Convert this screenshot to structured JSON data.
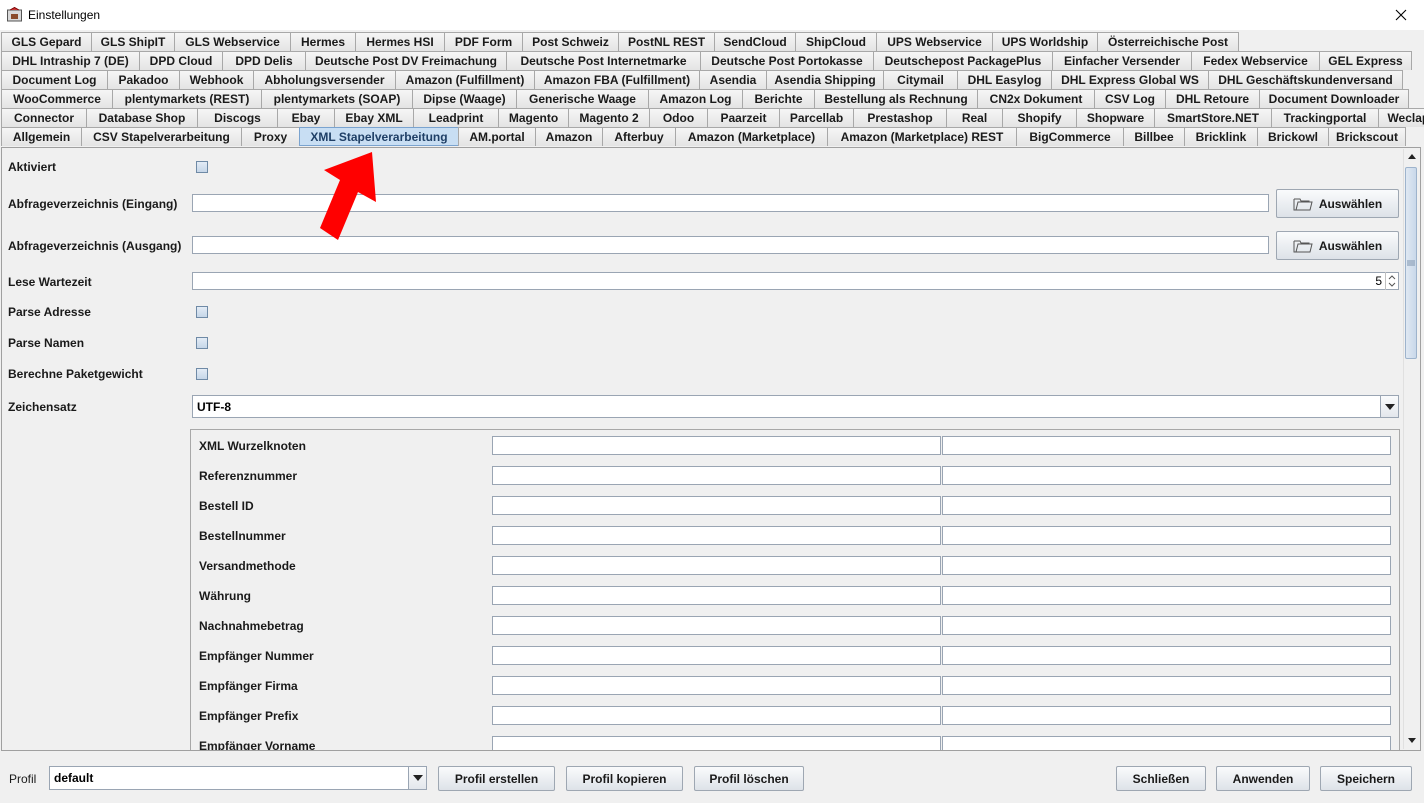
{
  "window": {
    "title": "Einstellungen",
    "close_glyph": "✕"
  },
  "tabs": {
    "rows": [
      [
        {
          "label": "GLS Gepard",
          "w": 91
        },
        {
          "label": "GLS ShipIT",
          "w": 84
        },
        {
          "label": "GLS Webservice",
          "w": 117
        },
        {
          "label": "Hermes",
          "w": 66
        },
        {
          "label": "Hermes HSI",
          "w": 90
        },
        {
          "label": "PDF Form",
          "w": 79
        },
        {
          "label": "Post Schweiz",
          "w": 97
        },
        {
          "label": "PostNL REST",
          "w": 97
        },
        {
          "label": "SendCloud",
          "w": 82
        },
        {
          "label": "ShipCloud",
          "w": 82
        },
        {
          "label": "UPS Webservice",
          "w": 117
        },
        {
          "label": "UPS Worldship",
          "w": 106
        },
        {
          "label": "Österreichische Post",
          "w": 142
        }
      ],
      [
        {
          "label": "DHL Intraship 7 (DE)",
          "w": 139
        },
        {
          "label": "DPD Cloud",
          "w": 84
        },
        {
          "label": "DPD Delis",
          "w": 84
        },
        {
          "label": "Deutsche Post DV Freimachung",
          "w": 202
        },
        {
          "label": "Deutsche Post Internetmarke",
          "w": 195
        },
        {
          "label": "Deutsche Post Portokasse",
          "w": 174
        },
        {
          "label": "Deutschepost PackagePlus",
          "w": 180
        },
        {
          "label": "Einfacher Versender",
          "w": 140
        },
        {
          "label": "Fedex Webservice",
          "w": 129
        },
        {
          "label": "GEL Express",
          "w": 93
        }
      ],
      [
        {
          "label": "Document Log",
          "w": 107
        },
        {
          "label": "Pakadoo",
          "w": 73
        },
        {
          "label": "Webhook",
          "w": 75
        },
        {
          "label": "Abholungsversender",
          "w": 143
        },
        {
          "label": "Amazon (Fulfillment)",
          "w": 140
        },
        {
          "label": "Amazon FBA (Fulfillment)",
          "w": 166
        },
        {
          "label": "Asendia",
          "w": 68
        },
        {
          "label": "Asendia Shipping",
          "w": 118
        },
        {
          "label": "Citymail",
          "w": 75
        },
        {
          "label": "DHL Easylog",
          "w": 95
        },
        {
          "label": "DHL Express Global WS",
          "w": 158
        },
        {
          "label": "DHL Geschäftskundenversand",
          "w": 195
        }
      ],
      [
        {
          "label": "WooCommerce",
          "w": 112
        },
        {
          "label": "plentymarkets (REST)",
          "w": 150
        },
        {
          "label": "plentymarkets (SOAP)",
          "w": 152
        },
        {
          "label": "Dipse (Waage)",
          "w": 105
        },
        {
          "label": "Generische Waage",
          "w": 133
        },
        {
          "label": "Amazon Log",
          "w": 95
        },
        {
          "label": "Berichte",
          "w": 73
        },
        {
          "label": "Bestellung als Rechnung",
          "w": 164
        },
        {
          "label": "CN2x Dokument",
          "w": 118
        },
        {
          "label": "CSV Log",
          "w": 72
        },
        {
          "label": "DHL Retoure",
          "w": 95
        },
        {
          "label": "Document Downloader",
          "w": 150
        }
      ],
      [
        {
          "label": "Connector",
          "w": 86
        },
        {
          "label": "Database Shop",
          "w": 112
        },
        {
          "label": "Discogs",
          "w": 81
        },
        {
          "label": "Ebay",
          "w": 58
        },
        {
          "label": "Ebay XML",
          "w": 80
        },
        {
          "label": "Leadprint",
          "w": 86
        },
        {
          "label": "Magento",
          "w": 71
        },
        {
          "label": "Magento 2",
          "w": 82
        },
        {
          "label": "Odoo",
          "w": 59
        },
        {
          "label": "Paarzeit",
          "w": 73
        },
        {
          "label": "Parcellab",
          "w": 75
        },
        {
          "label": "Prestashop",
          "w": 94
        },
        {
          "label": "Real",
          "w": 57
        },
        {
          "label": "Shopify",
          "w": 75
        },
        {
          "label": "Shopware",
          "w": 79
        },
        {
          "label": "SmartStore.NET",
          "w": 118
        },
        {
          "label": "Trackingportal",
          "w": 108
        },
        {
          "label": "Weclapp",
          "w": 68
        }
      ],
      [
        {
          "label": "Allgemein",
          "w": 81
        },
        {
          "label": "CSV Stapelverarbeitung",
          "w": 161
        },
        {
          "label": "Proxy",
          "w": 59
        },
        {
          "label": "XML Stapelverarbeitung",
          "w": 160,
          "selected": true
        },
        {
          "label": "AM.portal",
          "w": 78
        },
        {
          "label": "Amazon",
          "w": 68
        },
        {
          "label": "Afterbuy",
          "w": 74
        },
        {
          "label": "Amazon (Marketplace)",
          "w": 153
        },
        {
          "label": "Amazon (Marketplace) REST",
          "w": 190
        },
        {
          "label": "BigCommerce",
          "w": 108
        },
        {
          "label": "Billbee",
          "w": 62
        },
        {
          "label": "Bricklink",
          "w": 74
        },
        {
          "label": "Brickowl",
          "w": 72
        },
        {
          "label": "Brickscout",
          "w": 78
        }
      ]
    ]
  },
  "form": {
    "aktiviert_label": "Aktiviert",
    "eingang_label": "Abfrageverzeichnis (Eingang)",
    "eingang_value": "",
    "ausgang_label": "Abfrageverzeichnis (Ausgang)",
    "ausgang_value": "",
    "select_button": "Auswählen",
    "lese_label": "Lese Wartezeit",
    "lese_value": "5",
    "parse_adresse_label": "Parse Adresse",
    "parse_namen_label": "Parse Namen",
    "paketgewicht_label": "Berechne Paketgewicht",
    "zeichensatz_label": "Zeichensatz",
    "zeichensatz_value": "UTF-8"
  },
  "mapping": {
    "rows": [
      {
        "label": "XML Wurzelknoten",
        "value1": "",
        "value2": ""
      },
      {
        "label": "Referenznummer",
        "value1": "",
        "value2": ""
      },
      {
        "label": "Bestell ID",
        "value1": "",
        "value2": ""
      },
      {
        "label": "Bestellnummer",
        "value1": "",
        "value2": ""
      },
      {
        "label": "Versandmethode",
        "value1": "",
        "value2": ""
      },
      {
        "label": "Währung",
        "value1": "",
        "value2": ""
      },
      {
        "label": "Nachnahmebetrag",
        "value1": "",
        "value2": ""
      },
      {
        "label": "Empfänger Nummer",
        "value1": "",
        "value2": ""
      },
      {
        "label": "Empfänger Firma",
        "value1": "",
        "value2": ""
      },
      {
        "label": "Empfänger Prefix",
        "value1": "",
        "value2": ""
      },
      {
        "label": "Empfänger Vorname",
        "value1": "",
        "value2": ""
      }
    ]
  },
  "bottom": {
    "profil_label": "Profil",
    "profil_value": "default",
    "create": "Profil erstellen",
    "copy": "Profil kopieren",
    "delete": "Profil löschen",
    "close": "Schließen",
    "apply": "Anwenden",
    "save": "Speichern"
  },
  "colors": {
    "annotation_arrow": "#ff0000",
    "selected_tab": "#c8def3"
  }
}
